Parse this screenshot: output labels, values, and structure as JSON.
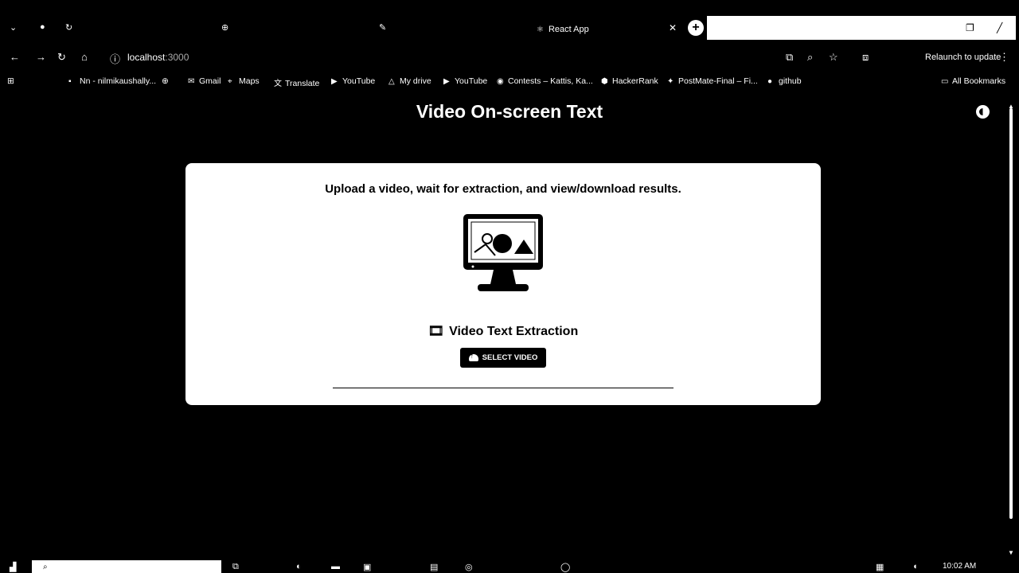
{
  "browser": {
    "active_tab_title": "React App",
    "url_host": "localhost",
    "url_port": ":3000",
    "relaunch_label": "Relaunch to update",
    "bookmarks": [
      {
        "label": "Nn - nilmikaushally..."
      },
      {
        "label": "Gmail"
      },
      {
        "label": "Maps"
      },
      {
        "label": "Translate"
      },
      {
        "label": "YouTube"
      },
      {
        "label": "My drive"
      },
      {
        "label": "YouTube"
      },
      {
        "label": "Contests – Kattis, Ka..."
      },
      {
        "label": "HackerRank"
      },
      {
        "label": "PostMate-Final – Fi..."
      },
      {
        "label": "github"
      }
    ],
    "all_bookmarks_label": "All Bookmarks"
  },
  "page": {
    "title": "Video On-screen Text",
    "subtitle": "Upload a video, wait for extraction, and view/download results.",
    "section_title": "Video Text Extraction",
    "select_button_label": "SELECT VIDEO"
  },
  "taskbar": {
    "time": "10:02 AM"
  },
  "icons": {
    "theme": "theme-toggle-icon",
    "monitor": "monitor-illustration-icon",
    "film": "film-projector-icon",
    "upload": "cloud-upload-icon"
  }
}
